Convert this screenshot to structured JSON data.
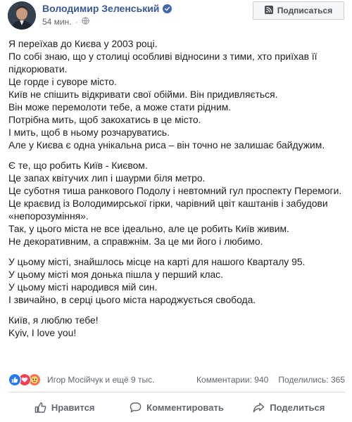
{
  "header": {
    "author": "Володимир Зеленський",
    "time": "54 мин.",
    "subscribe_label": "Подписаться",
    "verified_icon": "verified-badge-icon",
    "audience_icon": "globe-icon"
  },
  "post": {
    "paragraphs": [
      [
        "Я переїхав до Києва у 2003 році.",
        "По собі знаю, що у столиці особливі відносини з тими, хто приїхав її підкорювати.",
        "Це горде і суворе місто.",
        "Київ не спішить відкривати свої обійми. Він придивляється.",
        "Він може перемолоти тебе, а може стати рідним.",
        "Потрібна мить, щоб закохатись в це місто.",
        "І мить, щоб в ньому розчаруватись.",
        "Але у Києва є одна унікальна риса – він точно не залишає байдужим."
      ],
      [
        "Є те, що робить Київ - Києвом.",
        "Це запах квітучих лип і шаурми біля метро.",
        "Це суботня тиша ранкового Подолу і невтомний гул проспекту Перемоги.",
        "Це краєвид із Володимирської гірки, чарівний цвіт каштанів і забудови «непорозуміння».",
        "Так, у цього міста не все ідеально, але це робить Київ живим.",
        "Не декоративним, а справжнім. За це ми його і любимо."
      ],
      [
        "У цьому місті, знайшлось місце на карті для нашого Кварталу 95.",
        "У цьому місті моя донька пішла у перший клас.",
        "У цьому місті народився мій син.",
        "І звичайно, в серці цього міста народжується свобода."
      ],
      [
        "Київ, я люблю тебе!",
        "Kyiv, I love you!"
      ]
    ]
  },
  "reactions": {
    "names": "Игор Мосійчук и ещё 9 тыс.",
    "comments": "Комментарии: 940",
    "shares": "Поделились: 365"
  },
  "actions": {
    "like": "Нравится",
    "comment": "Комментировать",
    "share": "Поделиться"
  },
  "colors": {
    "author_link": "#385898",
    "like_reaction": "#2078f4",
    "love_reaction": "#f33e58",
    "angry_reaction": "#f7714b"
  }
}
